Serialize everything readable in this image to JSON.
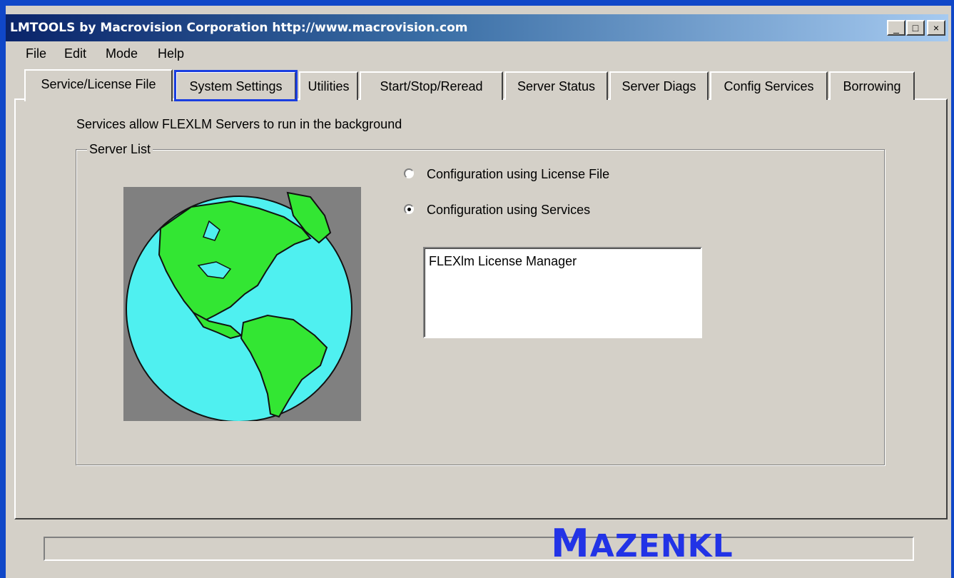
{
  "window": {
    "title": "LMTOOLS by Macrovision Corporation http://www.macrovision.com",
    "controls": {
      "minimize": "_",
      "maximize": "□",
      "close": "×"
    }
  },
  "menu": [
    "File",
    "Edit",
    "Mode",
    "Help"
  ],
  "tabs": [
    {
      "label": "Service/License File",
      "active": true
    },
    {
      "label": "System Settings",
      "highlighted": true
    },
    {
      "label": "Utilities"
    },
    {
      "label": "Start/Stop/Reread"
    },
    {
      "label": "Server Status"
    },
    {
      "label": "Server Diags"
    },
    {
      "label": "Config Services"
    },
    {
      "label": "Borrowing"
    }
  ],
  "panel": {
    "description": "Services allow FLEXLM Servers to run in the background",
    "group_label": "Server List",
    "radio_license_file": {
      "label": "Configuration using License File",
      "checked": false
    },
    "radio_services": {
      "label": "Configuration using Services",
      "checked": true
    },
    "services_list": [
      "FLEXlm License Manager"
    ]
  },
  "watermark": {
    "first": "M",
    "rest": "AZENKL"
  },
  "colors": {
    "highlight": "#1a3ee0",
    "globe_water": "#4ff0f0",
    "globe_land": "#33e633"
  }
}
